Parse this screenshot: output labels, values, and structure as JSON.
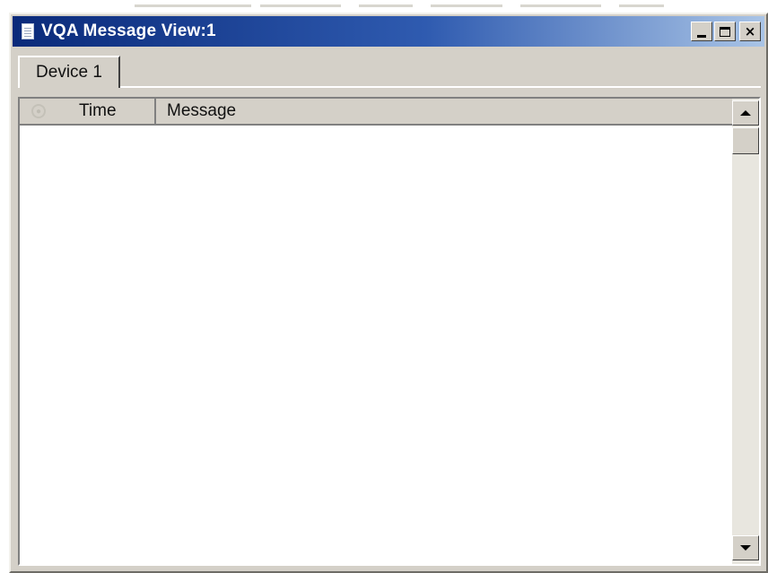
{
  "window": {
    "title": "VQA Message View:1",
    "icon": "document-icon",
    "caption_buttons": [
      "minimize",
      "maximize",
      "close"
    ],
    "close_glyph": "×"
  },
  "tabs": [
    {
      "label": "Device 1",
      "active": true
    }
  ],
  "list": {
    "columns": [
      {
        "key": "status",
        "label": "",
        "icon": "status-icon"
      },
      {
        "key": "time",
        "label": "Time"
      },
      {
        "key": "message",
        "label": "Message"
      }
    ],
    "rows": []
  },
  "colors": {
    "titlebar_start": "#0a2a7a",
    "titlebar_end": "#a9c4e6",
    "face": "#d4d0c8"
  }
}
